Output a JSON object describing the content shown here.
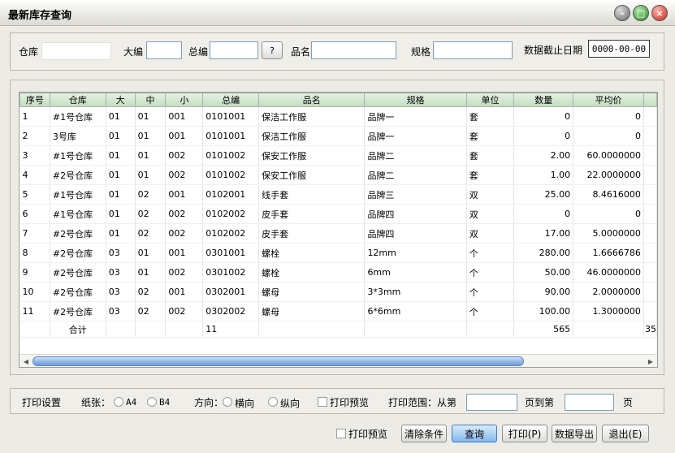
{
  "window": {
    "title": "最新库存查询"
  },
  "filter": {
    "warehouse_label": "仓库",
    "warehouse_value": "",
    "major_label": "大编",
    "major_value": "",
    "code_label": "总编",
    "code_value": "",
    "lookup_label": "?",
    "name_label": "品名",
    "name_value": "",
    "spec_label": "规格",
    "spec_value": "",
    "date_label": "数据截止日期",
    "date_value": "0000-00-00"
  },
  "table": {
    "columns": [
      "序号",
      "仓库",
      "大",
      "中",
      "小",
      "总编",
      "品名",
      "规格",
      "单位",
      "数量",
      "平均价"
    ],
    "rows": [
      [
        "1",
        "#1号仓库",
        "01",
        "01",
        "001",
        "0101001",
        "保洁工作服",
        "品牌一",
        "套",
        "0",
        "0"
      ],
      [
        "2",
        "3号库",
        "01",
        "01",
        "001",
        "0101001",
        "保洁工作服",
        "品牌一",
        "套",
        "0",
        "0"
      ],
      [
        "3",
        "#1号仓库",
        "01",
        "01",
        "002",
        "0101002",
        "保安工作服",
        "品牌二",
        "套",
        "2.00",
        "60.0000000"
      ],
      [
        "4",
        "#2号仓库",
        "01",
        "01",
        "002",
        "0101002",
        "保安工作服",
        "品牌二",
        "套",
        "1.00",
        "22.0000000"
      ],
      [
        "5",
        "#1号仓库",
        "01",
        "02",
        "001",
        "0102001",
        "线手套",
        "品牌三",
        "双",
        "25.00",
        "8.4616000"
      ],
      [
        "6",
        "#1号仓库",
        "01",
        "02",
        "002",
        "0102002",
        "皮手套",
        "品牌四",
        "双",
        "0",
        "0"
      ],
      [
        "7",
        "#2号仓库",
        "01",
        "02",
        "002",
        "0102002",
        "皮手套",
        "品牌四",
        "双",
        "17.00",
        "5.0000000"
      ],
      [
        "8",
        "#2号仓库",
        "03",
        "01",
        "001",
        "0301001",
        "螺栓",
        "12mm",
        "个",
        "280.00",
        "1.6666786"
      ],
      [
        "9",
        "#2号仓库",
        "03",
        "01",
        "002",
        "0301002",
        "螺栓",
        "6mm",
        "个",
        "50.00",
        "46.0000000"
      ],
      [
        "10",
        "#2号仓库",
        "03",
        "02",
        "001",
        "0302001",
        "螺母",
        "3*3mm",
        "个",
        "90.00",
        "2.0000000"
      ],
      [
        "11",
        "#2号仓库",
        "03",
        "02",
        "002",
        "0302002",
        "螺母",
        "6*6mm",
        "个",
        "100.00",
        "1.3000000"
      ]
    ],
    "total": {
      "label": "合计",
      "code": "11",
      "quantity": "565",
      "overflow": "35"
    }
  },
  "print": {
    "settings_label": "打印设置",
    "paper_label": "纸张：",
    "paper_a4": "A4",
    "paper_b4": "B4",
    "orientation_label": "方向：",
    "landscape": "横向",
    "portrait": "纵向",
    "preview_label": "打印预览",
    "range_label": "打印范围：从第",
    "range_from": "",
    "range_to_label": "页到第",
    "range_to": "",
    "range_end_label": "页"
  },
  "actions": {
    "preview_label": "打印预览",
    "clear_label": "清除条件",
    "query_label": "查询",
    "print_label": "打印(P)",
    "export_label": "数据导出",
    "exit_label": "退出(E)"
  },
  "icons": {
    "minimize": "minimize-icon",
    "maximize": "maximize-icon",
    "close": "close-icon",
    "scroll_left": "arrow-left-icon",
    "scroll_right": "arrow-right-icon"
  }
}
